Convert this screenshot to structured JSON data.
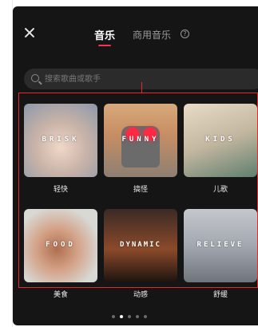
{
  "header": {
    "close_icon": "close-icon",
    "tab_music": "音乐",
    "tab_commercial": "商用音乐",
    "help_icon_glyph": "?",
    "accent_color": "#ff2e55"
  },
  "search": {
    "placeholder": "搜索歌曲或歌手"
  },
  "categories": [
    {
      "overlay": "BRISK",
      "label": "轻快"
    },
    {
      "overlay": "FUNNY",
      "label": "搞怪"
    },
    {
      "overlay": "KIDS",
      "label": "儿歌"
    },
    {
      "overlay": "FOOD",
      "label": "美食"
    },
    {
      "overlay": "DYNAMIC",
      "label": "动感"
    },
    {
      "overlay": "RELIEVE",
      "label": "舒缓"
    }
  ],
  "pagination": {
    "pages": 5,
    "current": 2
  },
  "highlight_color": "#e8282d"
}
